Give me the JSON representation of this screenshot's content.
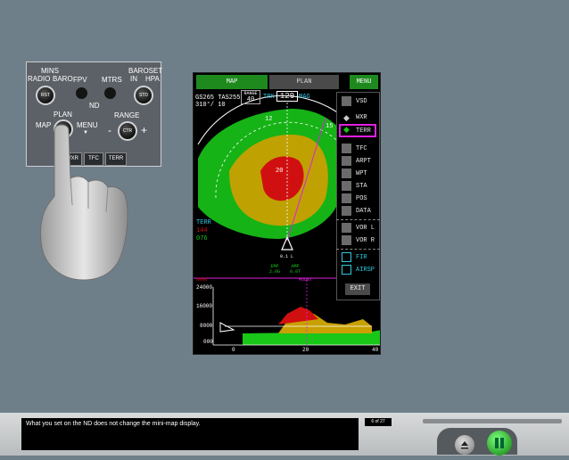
{
  "efis_panel": {
    "mins_label": "MINS",
    "radio_label": "RADIO",
    "baro_label": "BARO",
    "fpv_label": "FPV",
    "mtrs_label": "MTRS",
    "baroset_label": "BAROSET",
    "in_label": "IN",
    "hpa_label": "HPA",
    "rst_label": "RST",
    "std_label": "STD",
    "nd_label": "ND",
    "plan_label": "PLAN",
    "map_label": "MAP",
    "menu_label": "MENU",
    "range_label": "RANGE",
    "ctr_label": "CTR",
    "minus_label": "-",
    "plus_label": "+",
    "wxr_button": "WXR",
    "tfc_button": "TFC",
    "terr_button": "TERR"
  },
  "nd": {
    "tab_map": "MAP",
    "tab_plan": "PLAN",
    "menu_button": "MENU",
    "gs_line": "GS265 TAS255",
    "wind_line": "310°/ 10",
    "range_label": "RANGE",
    "range_value": "40",
    "trk_label": "TRK",
    "heading_value": "129",
    "mag_label": "MAG",
    "compass_12": "12",
    "compass_15": "15",
    "range_ring_20": "20",
    "terr_label": "TERR",
    "terr_high": "144",
    "terr_low": "076",
    "aircraft_scale": "0.1 L",
    "emp_label": "EMP",
    "emp_value": "2.0G",
    "amp_label": "AMP",
    "amp_value": "0.0T",
    "menu_items": [
      "VSD",
      "WXR",
      "TERR",
      "TFC",
      "ARPT",
      "WPT",
      "STA",
      "POS",
      "DATA",
      "VOR L",
      "VOR R",
      "FIR",
      "AIRSP",
      "EXIT"
    ],
    "vsd": {
      "top_left": "6000",
      "top_mid": "MOUNT",
      "y_labels": [
        "24000",
        "16000",
        "8000",
        "000"
      ],
      "x_labels": [
        "0",
        "20",
        "40"
      ]
    }
  },
  "bottom_bar": {
    "caption": "What you set on the ND does not change the mini-map display.",
    "page_counter": "6 of 27"
  },
  "colors": {
    "background": "#6f7f8a",
    "nd_green_tab": "#1e8a1e",
    "terrain_green": "#18c718",
    "terrain_yellow": "#c8a000",
    "terrain_red": "#d01010",
    "magenta": "#e020e0",
    "cyan": "#30c8e0"
  },
  "icons": [
    "hand-pointer-icon",
    "aircraft-symbol-icon",
    "eject-icon",
    "pause-icon"
  ]
}
